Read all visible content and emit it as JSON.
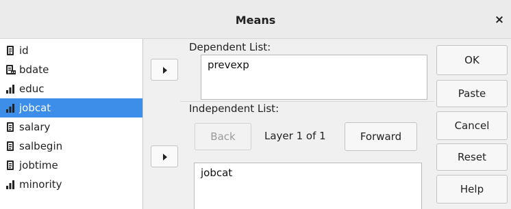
{
  "window": {
    "title": "Means",
    "close_glyph": "×"
  },
  "variables": [
    {
      "label": "id",
      "icon": "scale-variable-icon",
      "selected": false
    },
    {
      "label": "bdate",
      "icon": "date-variable-icon",
      "selected": false
    },
    {
      "label": "educ",
      "icon": "ordinal-variable-icon",
      "selected": false
    },
    {
      "label": "jobcat",
      "icon": "ordinal-variable-icon",
      "selected": true
    },
    {
      "label": "salary",
      "icon": "scale-variable-icon",
      "selected": false
    },
    {
      "label": "salbegin",
      "icon": "scale-variable-icon",
      "selected": false
    },
    {
      "label": "jobtime",
      "icon": "scale-variable-icon",
      "selected": false
    },
    {
      "label": "minority",
      "icon": "ordinal-variable-icon",
      "selected": false
    }
  ],
  "dependent": {
    "label": "Dependent List:",
    "items": [
      "prevexp"
    ]
  },
  "independent": {
    "label": "Independent List:",
    "back": "Back",
    "layer_text": "Layer 1 of 1",
    "forward": "Forward",
    "items": [
      "jobcat"
    ]
  },
  "actions": {
    "ok": "OK",
    "paste": "Paste",
    "cancel": "Cancel",
    "reset": "Reset",
    "help": "Help"
  },
  "colors": {
    "selection": "#3d8ee8",
    "icon_dark": "#222222"
  }
}
